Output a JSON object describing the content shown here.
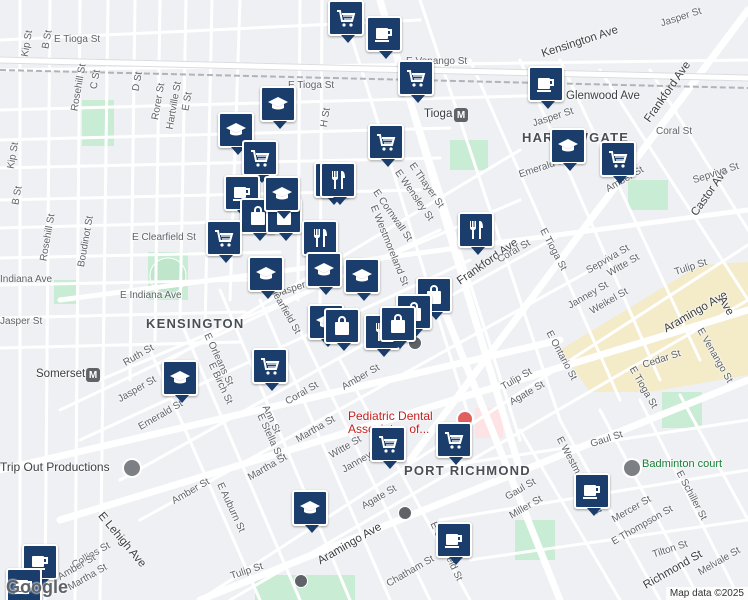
{
  "neighborhoods": [
    "HARROWGATE",
    "KENSINGTON",
    "PORT RICHMOND"
  ],
  "streets": [
    "Kensington Ave",
    "Jasper St",
    "E Tioga St",
    "Kip St",
    "B St",
    "E Venango St",
    "Glenwood Ave",
    "E Tioga St",
    "Rosehill St",
    "C St",
    "D St",
    "Rorer St",
    "Hartville St",
    "E St",
    "H St",
    "Tioga",
    "Frankford Ave",
    "Coral St",
    "Kip St",
    "B St",
    "Jasper St",
    "E Thayer St",
    "E Wensley St",
    "E Cornwall St",
    "E Westmoreland St",
    "Emerald St",
    "Amber St",
    "Castor Ave",
    "Sepviva St",
    "Boudinot St",
    "Rosehill St",
    "E Clearfield St",
    "Frankford Ave",
    "Coral St",
    "E Tioga St",
    "Sepviva St",
    "Witte St",
    "Tulip St",
    "E Indiana Ave",
    "Indiana Ave",
    "Jasper St",
    "E Clearfield St",
    "Janney St",
    "Weikel St",
    "Aramingo Ave",
    "Ruth St",
    "E Orleans St",
    "E Birch St",
    "E Ontario St",
    "Cedar St",
    "E Venango St",
    "Jasper St",
    "Coral St",
    "Amber St",
    "Tulip St",
    "Agate St",
    "E Tioga St",
    "Emerald St",
    "Martha St",
    "Amber St",
    "Witte St",
    "Janney St",
    "Gaul St",
    "Ann St",
    "E Stella St",
    "Martha St",
    "Amber St",
    "E Auburn St",
    "Agate St",
    "Gaul St",
    "Miller St",
    "E Westmoreland St",
    "Aramingo Ave",
    "E Schiller St",
    "Mercer St",
    "E Thompson St",
    "Tilton St",
    "E Lehigh Ave",
    "Collins St",
    "Amber St",
    "Martha St",
    "E Clearfield St",
    "Chatham St",
    "Tulip St",
    "Richmond St",
    "Melvale St",
    "Aramingo Ave",
    "Ave",
    "Amber St",
    "Frankford Ave",
    "Jasper",
    "Emerald"
  ],
  "places": {
    "somerset": "Somerset",
    "tioga_station": "Tioga",
    "trip_out": "Trip Out Productions",
    "pediatric": "Pediatric Dental Associates of...",
    "badminton": "Badminton court"
  },
  "station_letter": "M",
  "attribution": "Map data ©2025",
  "logo": "Google",
  "colors": {
    "poi_fill": "#1a3d6b",
    "park": "#c9ecd4",
    "industrial": "#f4ebc9",
    "road_major": "#ffffff",
    "road_minor": "#ffffff"
  },
  "pois": [
    {
      "icon": "cart-icon",
      "type": "grocery"
    },
    {
      "icon": "cup-icon",
      "type": "cafe"
    },
    {
      "icon": "cart-icon",
      "type": "grocery"
    },
    {
      "icon": "cup-icon",
      "type": "cafe"
    },
    {
      "icon": "school-icon",
      "type": "school"
    },
    {
      "icon": "school-icon",
      "type": "school"
    },
    {
      "icon": "cart-icon",
      "type": "grocery"
    },
    {
      "icon": "cart-icon",
      "type": "grocery"
    },
    {
      "icon": "school-icon",
      "type": "school"
    },
    {
      "icon": "cart-icon",
      "type": "grocery"
    },
    {
      "icon": "cup-icon",
      "type": "cafe"
    },
    {
      "icon": "fork-knife-icon",
      "type": "restaurant"
    },
    {
      "icon": "fork-knife-icon",
      "type": "restaurant"
    },
    {
      "icon": "shopping-bag-icon",
      "type": "store"
    },
    {
      "icon": "shopping-bag-icon",
      "type": "store"
    },
    {
      "icon": "cart-icon",
      "type": "grocery"
    },
    {
      "icon": "fork-knife-icon",
      "type": "restaurant"
    },
    {
      "icon": "fork-knife-icon",
      "type": "restaurant"
    },
    {
      "icon": "school-icon",
      "type": "school"
    },
    {
      "icon": "school-icon",
      "type": "school"
    },
    {
      "icon": "school-icon",
      "type": "school"
    },
    {
      "icon": "shopping-bag-icon",
      "type": "store"
    },
    {
      "icon": "shopping-bag-icon",
      "type": "store"
    },
    {
      "icon": "school-icon",
      "type": "school"
    },
    {
      "icon": "shopping-bag-icon",
      "type": "store"
    },
    {
      "icon": "fork-knife-icon",
      "type": "restaurant"
    },
    {
      "icon": "shopping-bag-icon",
      "type": "store"
    },
    {
      "icon": "cart-icon",
      "type": "grocery"
    },
    {
      "icon": "school-icon",
      "type": "school"
    },
    {
      "icon": "cart-icon",
      "type": "grocery"
    },
    {
      "icon": "cart-icon",
      "type": "grocery"
    },
    {
      "icon": "school-icon",
      "type": "school"
    },
    {
      "icon": "cup-icon",
      "type": "cafe"
    },
    {
      "icon": "cup-icon",
      "type": "cafe"
    },
    {
      "icon": "cup-icon",
      "type": "cafe"
    },
    {
      "icon": "cup-icon",
      "type": "cafe"
    },
    {
      "icon": "school-icon",
      "type": "school"
    }
  ]
}
